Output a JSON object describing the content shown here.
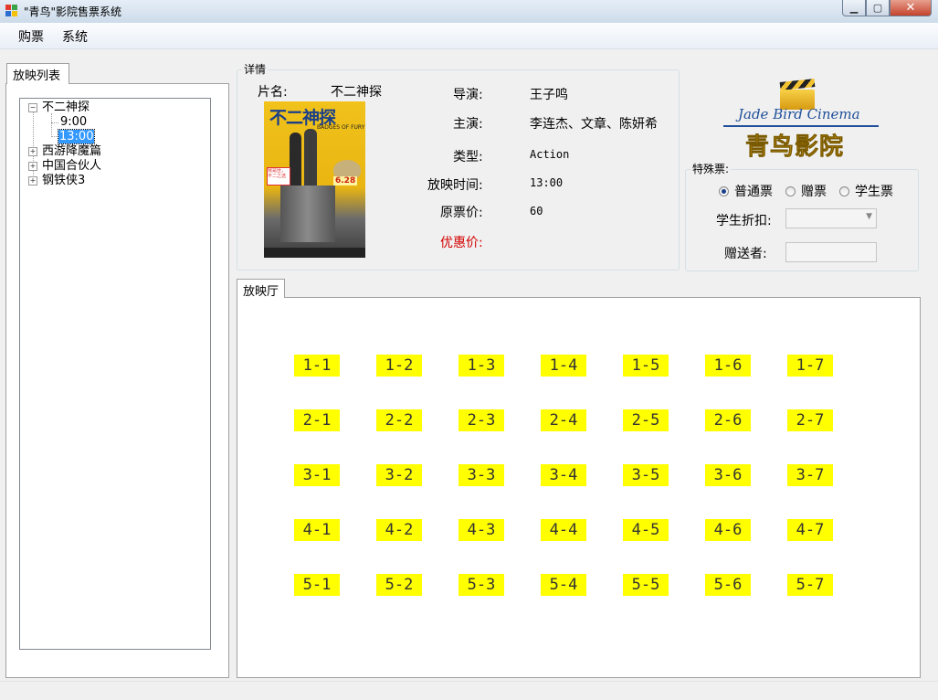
{
  "window": {
    "title": "\"青鸟\"影院售票系统",
    "minimize_glyph": "▁",
    "maximize_glyph": "▢",
    "close_glyph": "✕"
  },
  "menu": {
    "items": [
      "购票",
      "系统"
    ]
  },
  "left_tab": {
    "label": "放映列表",
    "tree": [
      {
        "label": "不二神探",
        "expanded": true,
        "children": [
          "9:00",
          "13:00"
        ],
        "selected_child": "13:00"
      },
      {
        "label": "西游降魔篇",
        "expanded": false
      },
      {
        "label": "中国合伙人",
        "expanded": false
      },
      {
        "label": "钢铁侠3",
        "expanded": false
      }
    ]
  },
  "details": {
    "group_label": "详情",
    "title_label": "片名:",
    "title_value": "不二神探",
    "director_label": "导演:",
    "director_value": "王子鸣",
    "actors_label": "主演:",
    "actors_value": "李连杰、文章、陈妍希",
    "genre_label": "类型:",
    "genre_value": "Action",
    "time_label": "放映时间:",
    "time_value": "13:00",
    "price_label": "原票价:",
    "price_value": "60",
    "discount_label": "优惠价:",
    "discount_value": "",
    "poster": {
      "title_art": "不二神探",
      "subtitle_art": "BADGES OF FURY",
      "date_art": "6.28",
      "tag_art": "我是匪，不二之选",
      "icon": "poster-image"
    }
  },
  "logo": {
    "english": "Jade Bird Cinema",
    "chinese": "青鸟影院",
    "icon": "clapperboard-icon"
  },
  "special": {
    "group_label": "特殊票:",
    "radio_options": [
      "普通票",
      "赠票",
      "学生票"
    ],
    "selected": "普通票",
    "student_discount_label": "学生折扣:",
    "student_discount_value": "",
    "gifter_label": "赠送者:",
    "gifter_value": ""
  },
  "hall": {
    "tab_label": "放映厅",
    "seats": [
      [
        "1-1",
        "1-2",
        "1-3",
        "1-4",
        "1-5",
        "1-6",
        "1-7"
      ],
      [
        "2-1",
        "2-2",
        "2-3",
        "2-4",
        "2-5",
        "2-6",
        "2-7"
      ],
      [
        "3-1",
        "3-2",
        "3-3",
        "3-4",
        "3-5",
        "3-6",
        "3-7"
      ],
      [
        "4-1",
        "4-2",
        "4-3",
        "4-4",
        "4-5",
        "4-6",
        "4-7"
      ],
      [
        "5-1",
        "5-2",
        "5-3",
        "5-4",
        "5-5",
        "5-6",
        "5-7"
      ]
    ]
  },
  "colors": {
    "seat_available": "#ffff00",
    "discount_label": "#d40000",
    "selection": "#3399ff",
    "logo_blue": "#1f4f9a",
    "logo_gold": "#e0a81c"
  }
}
